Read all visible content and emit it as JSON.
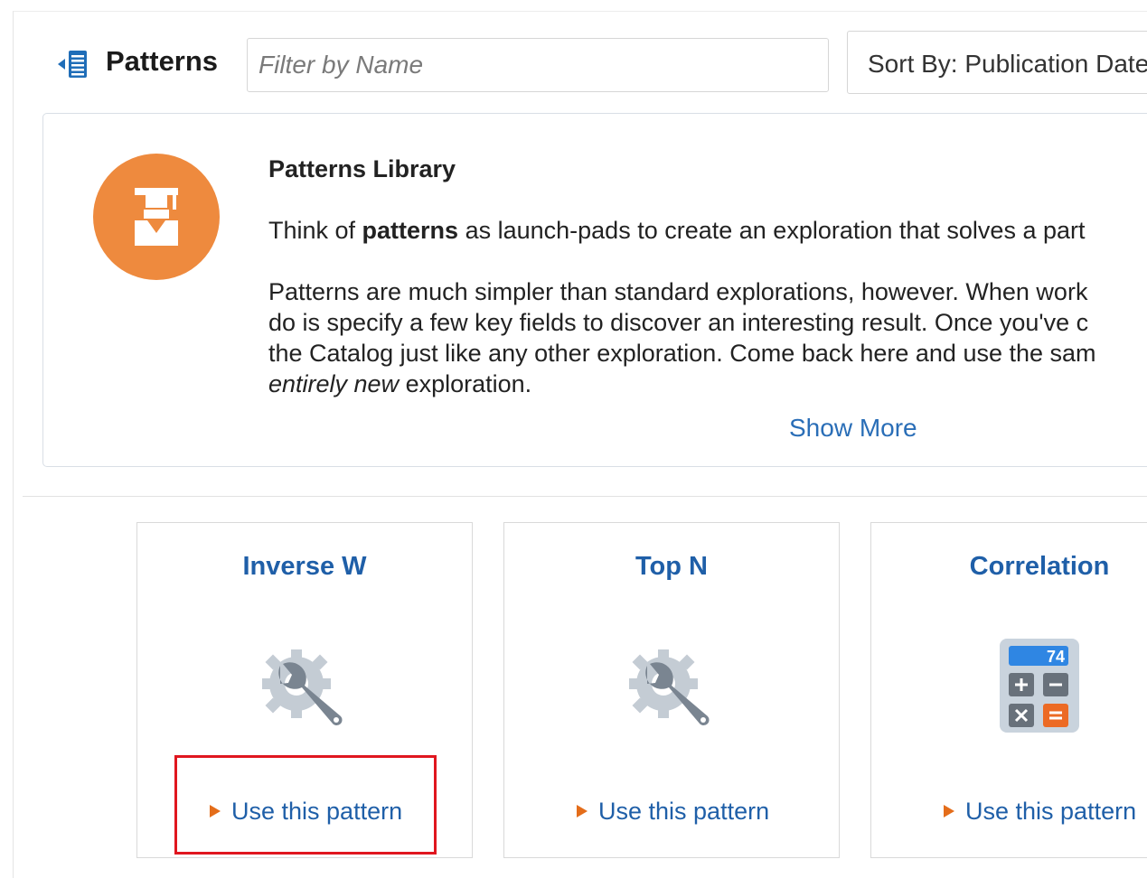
{
  "header": {
    "title": "Patterns",
    "collapse_icon": "panel-collapse-icon",
    "filter_placeholder": "Filter by Name",
    "sort_label": "Sort By: Publication Date"
  },
  "info": {
    "icon": "graduate-badge-icon",
    "badge_color": "#ee8a3e",
    "title": "Patterns Library",
    "p1_prefix": "Think of ",
    "p1_bold": "patterns",
    "p1_suffix": " as launch-pads to create an exploration that solves a part",
    "p2_line1": "Patterns are much simpler than standard explorations, however. When work",
    "p2_line2": "do is specify a few key fields to discover an interesting result. Once you've c",
    "p2_line3": "the Catalog just like any other exploration. Come back here and use the sam",
    "p2_italic": "entirely new",
    "p2_end": " exploration.",
    "show_more": "Show More"
  },
  "cards": [
    {
      "title": "Inverse W",
      "icon": "gear-wrench-icon",
      "link": "Use this pattern"
    },
    {
      "title": "Top N",
      "icon": "gear-wrench-icon",
      "link": "Use this pattern"
    },
    {
      "title": "Correlation",
      "icon": "calculator-icon",
      "icon_number": "74",
      "link": "Use this pattern"
    }
  ],
  "colors": {
    "link": "#1f5fa8",
    "arrow": "#e46d1a",
    "highlight": "#e0161f"
  }
}
